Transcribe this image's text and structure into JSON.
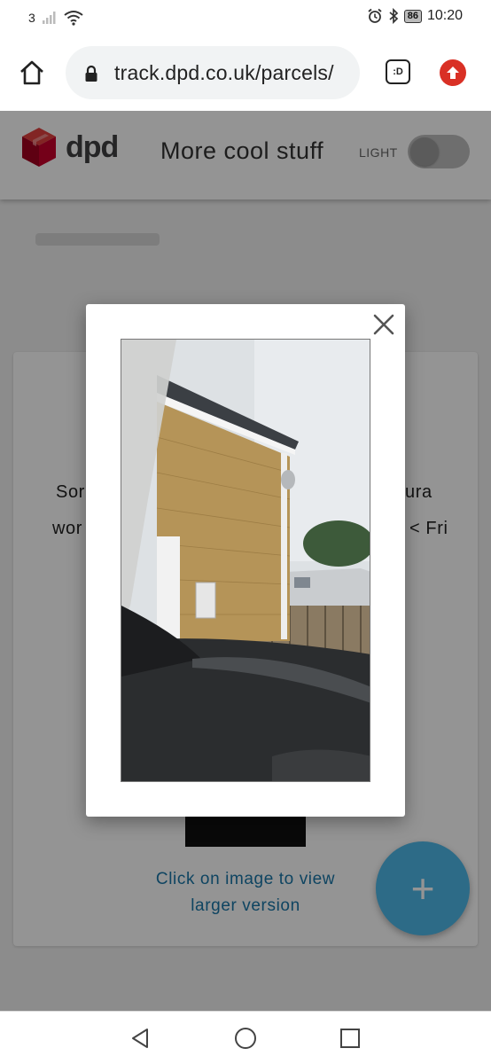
{
  "status_bar": {
    "carrier": "3",
    "battery": "86",
    "time": "10:20",
    "icons": [
      "signal-icon",
      "wifi-icon",
      "alarm-icon",
      "bluetooth-icon",
      "battery-icon"
    ]
  },
  "browser": {
    "url": "track.dpd.co.uk/parcels/",
    "tab_switcher_label": ":D",
    "icons": [
      "home-icon",
      "lock-icon",
      "tab-switcher-icon",
      "upgrade-arrow-icon"
    ]
  },
  "site_header": {
    "logo_text": "dpd",
    "nav_link": "More cool stuff",
    "theme_label": "LIGHT"
  },
  "card": {
    "text_line1_left": "Sor",
    "text_line1_right": "ura",
    "text_line2_left": "wor",
    "text_line2_right": "< Fri",
    "click_message": "Click on image to view larger version"
  },
  "fab": {
    "label": "+"
  },
  "colors": {
    "dpd_red": "#dc0032",
    "link_blue": "#1976a8",
    "fab_blue": "#4fb8e8",
    "chrome_red": "#d93025"
  },
  "navigation": {
    "icons": [
      "back-triangle-icon",
      "home-circle-icon",
      "recents-square-icon"
    ]
  }
}
